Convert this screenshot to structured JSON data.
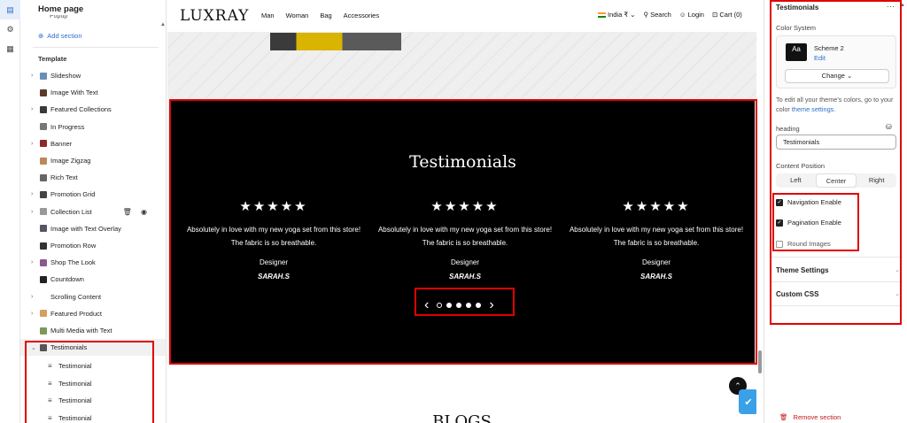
{
  "rail": {
    "icons": [
      "layout-icon",
      "gear-icon",
      "apps-icon"
    ]
  },
  "left": {
    "title": "Home page",
    "popup_label": "Popup",
    "add_section": "Add section",
    "template_label": "Template",
    "items": [
      {
        "label": "Slideshow",
        "chev": "›"
      },
      {
        "label": "Image With Text",
        "chev": ""
      },
      {
        "label": "Featured Collections",
        "chev": "›"
      },
      {
        "label": "In Progress",
        "chev": ""
      },
      {
        "label": "Banner",
        "chev": "›"
      },
      {
        "label": "Image Zigzag",
        "chev": ""
      },
      {
        "label": "Rich Text",
        "chev": ""
      },
      {
        "label": "Promotion Grid",
        "chev": "›"
      },
      {
        "label": "Collection List",
        "chev": "›"
      },
      {
        "label": "Image with Text Overlay",
        "chev": ""
      },
      {
        "label": "Promotion Row",
        "chev": ""
      },
      {
        "label": "Shop The Look",
        "chev": "›"
      },
      {
        "label": "Countdown",
        "chev": ""
      },
      {
        "label": "Scrolling Content",
        "chev": "›"
      },
      {
        "label": "Featured Product",
        "chev": "›"
      },
      {
        "label": "Multi Media with Text",
        "chev": ""
      },
      {
        "label": "Testimonials",
        "chev": "⌄"
      }
    ],
    "sub_items": [
      "Testimonial",
      "Testimonial",
      "Testimonial",
      "Testimonial"
    ]
  },
  "store": {
    "logo": "LUXRAY",
    "menu": [
      "Man",
      "Woman",
      "Bag",
      "Accessories"
    ],
    "country": "India ₹",
    "search": "Search",
    "login": "Login",
    "cart": "Cart (0)"
  },
  "testimonials": {
    "title": "Testimonials",
    "cards": [
      {
        "stars": "★★★★★",
        "quote": "Absolutely in love with my new yoga set from this store! The fabric is so breathable.",
        "role": "Designer",
        "name": "SARAH.S"
      },
      {
        "stars": "★★★★★",
        "quote": "Absolutely in love with my new yoga set from this store! The fabric is so breathable.",
        "role": "Designer",
        "name": "SARAH.S"
      },
      {
        "stars": "★★★★★",
        "quote": "Absolutely in love with my new yoga set from this store! The fabric is so breathable.",
        "role": "Designer",
        "name": "SARAH.S"
      }
    ],
    "prev": "‹",
    "next": "›"
  },
  "blogs_title": "BLOGS",
  "right": {
    "header": "Testimonials",
    "color_system_label": "Color System",
    "scheme_name": "Scheme 2",
    "scheme_edit": "Edit",
    "change_btn": "Change ⌄",
    "note_text": "To edit all your theme's colors, go to your color",
    "note_link": "theme settings.",
    "heading_label": "heading",
    "heading_value": "Testimonials",
    "content_position_label": "Content Position",
    "positions": [
      "Left",
      "Center",
      "Right"
    ],
    "active_position": "Center",
    "checkboxes": [
      {
        "label": "Navigation Enable",
        "checked": true
      },
      {
        "label": "Pagination Enable",
        "checked": true
      },
      {
        "label": "Round Images",
        "checked": false
      }
    ],
    "theme_settings": "Theme Settings",
    "custom_css": "Custom CSS",
    "remove_section": "Remove section"
  },
  "colors": {
    "accent": "#2c6ecb",
    "highlight": "#e00000",
    "danger": "#c0161b"
  }
}
